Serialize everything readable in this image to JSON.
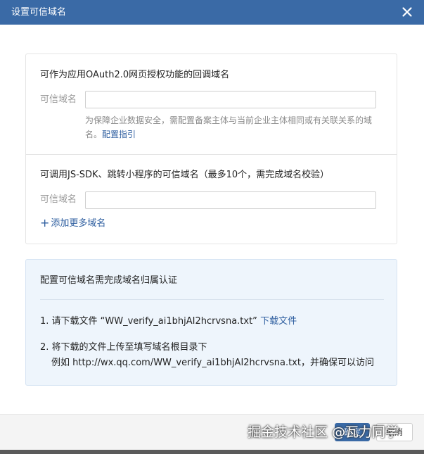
{
  "dialog": {
    "title": "设置可信域名",
    "close_icon": "close-icon"
  },
  "oauth_section": {
    "heading": "可作为应用OAuth2.0网页授权功能的回调域名",
    "field_label": "可信域名",
    "field_value": "",
    "hint_text": "为保障企业数据安全，需配置备案主体与当前企业主体相同或有关联关系的域名。",
    "hint_link": "配置指引"
  },
  "jssdk_section": {
    "heading": "可调用JS-SDK、跳转小程序的可信域名（最多10个，需完成域名校验）",
    "field_label": "可信域名",
    "field_value": "",
    "add_more_icon": "plus-icon",
    "add_more_label": "添加更多域名"
  },
  "verification": {
    "title": "配置可信域名需完成域名归属认证",
    "step1_text": "1. 请下载文件 “WW_verify_ai1bhjAI2hcrvsna.txt”",
    "step1_link": "下载文件",
    "step2_text": "2. 将下载的文件上传至填写域名根目录下",
    "step2_example": "例如 http://wx.qq.com/WW_verify_ai1bhjAI2hcrvsna.txt，并确保可以访问"
  },
  "footer": {
    "confirm_label": "确定",
    "cancel_label": "取消"
  },
  "watermark": {
    "text": "掘金技术社区 @瓦力同学"
  },
  "colors": {
    "titlebar": "#3a6aa6",
    "link": "#2f5fa0",
    "info_background": "#eef5fc"
  }
}
